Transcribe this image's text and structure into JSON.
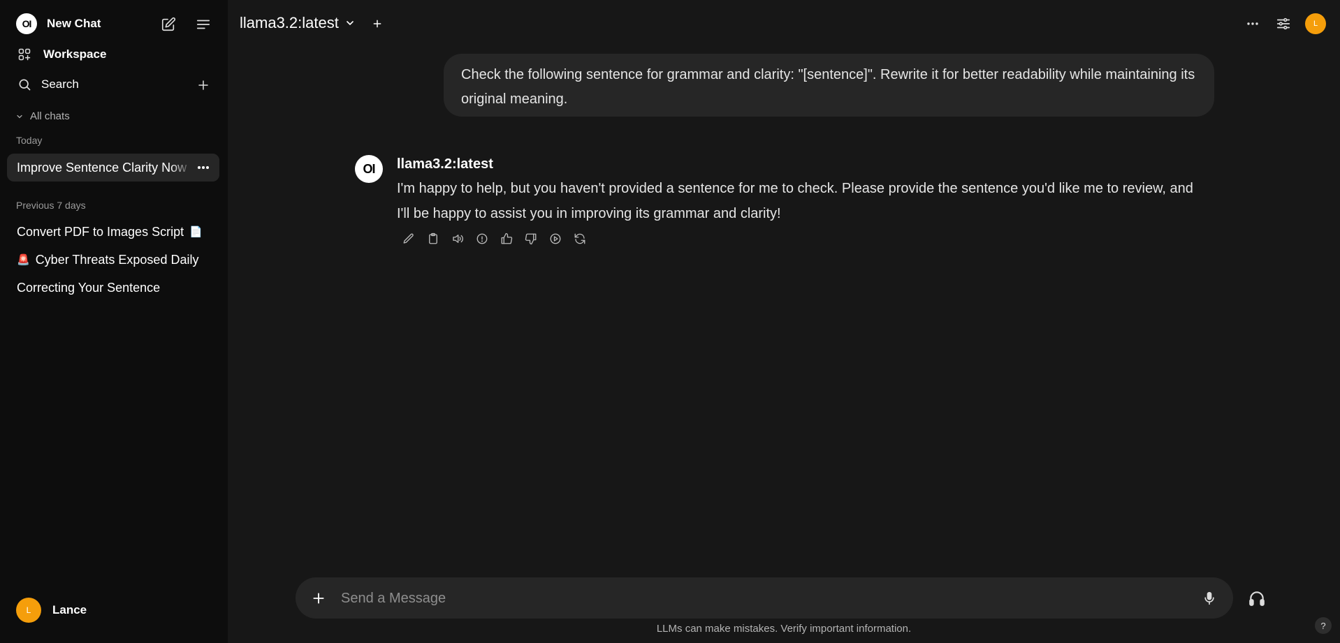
{
  "sidebar": {
    "app_title": "New Chat",
    "logo_text": "OI",
    "workspace_label": "Workspace",
    "search_label": "Search",
    "all_chats_label": "All chats",
    "sections": {
      "today": "Today",
      "previous": "Previous 7 days"
    },
    "today_chats": [
      {
        "title": "Improve Sentence Clarity Now"
      }
    ],
    "previous_chats": [
      {
        "title": "Convert PDF to Images Script",
        "emoji": "📄"
      },
      {
        "title": "Cyber Threats Exposed Daily",
        "emoji": "🚨"
      },
      {
        "title": "Correcting Your Sentence"
      }
    ],
    "user": {
      "name": "Lance",
      "initial": "L"
    }
  },
  "header": {
    "model": "llama3.2:latest",
    "user_initial": "L"
  },
  "messages": {
    "user_text": "Check the following sentence for grammar and clarity: \"[sentence]\". Rewrite it for better readability while maintaining its original meaning.",
    "assistant_name": "llama3.2:latest",
    "assistant_text": "I'm happy to help, but you haven't provided a sentence for me to check. Please provide the sentence you'd like me to review, and I'll be happy to assist you in improving its grammar and clarity!"
  },
  "composer": {
    "placeholder": "Send a Message"
  },
  "footer": {
    "disclaimer": "LLMs can make mistakes. Verify important information.",
    "help": "?"
  },
  "colors": {
    "accent_avatar": "#f59e0b",
    "background": "#171717",
    "sidebar": "#0d0d0d"
  }
}
